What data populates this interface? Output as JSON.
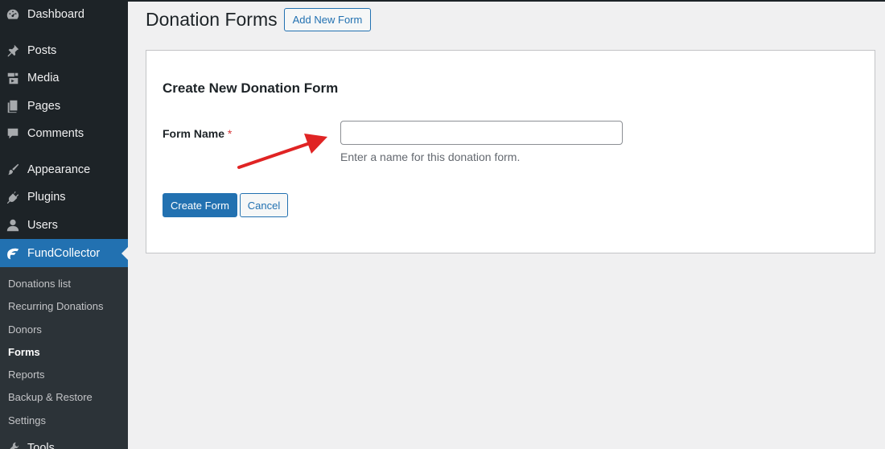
{
  "sidebar": {
    "items": [
      {
        "label": "Dashboard",
        "icon": "dashboard-icon"
      },
      {
        "label": "Posts",
        "icon": "pin-icon"
      },
      {
        "label": "Media",
        "icon": "media-icon"
      },
      {
        "label": "Pages",
        "icon": "pages-icon"
      },
      {
        "label": "Comments",
        "icon": "comment-icon"
      },
      {
        "label": "Appearance",
        "icon": "brush-icon"
      },
      {
        "label": "Plugins",
        "icon": "plug-icon"
      },
      {
        "label": "Users",
        "icon": "user-icon"
      },
      {
        "label": "FundCollector",
        "icon": "fundcollector-icon"
      },
      {
        "label": "Tools",
        "icon": "wrench-icon"
      }
    ],
    "submenu": [
      "Donations list",
      "Recurring Donations",
      "Donors",
      "Forms",
      "Reports",
      "Backup & Restore",
      "Settings"
    ],
    "current_sub": "Forms"
  },
  "header": {
    "title": "Donation Forms",
    "add_new_label": "Add New Form"
  },
  "form": {
    "title": "Create New Donation Form",
    "name_label": "Form Name",
    "required_mark": "*",
    "name_value": "",
    "help_text": "Enter a name for this donation form.",
    "create_label": "Create Form",
    "cancel_label": "Cancel"
  },
  "colors": {
    "accent": "#2271b1",
    "sidebar_bg": "#1d2327",
    "submenu_bg": "#2c3338",
    "annotation_arrow": "#e02424"
  }
}
